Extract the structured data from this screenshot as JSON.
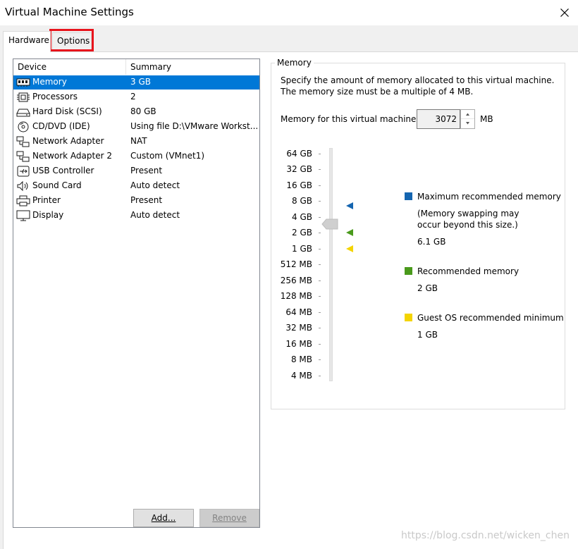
{
  "window": {
    "title": "Virtual Machine Settings"
  },
  "tabs": {
    "hardware": "Hardware",
    "options": "Options"
  },
  "device_list": {
    "headers": {
      "device": "Device",
      "summary": "Summary"
    },
    "rows": [
      {
        "icon": "memory-icon",
        "device": "Memory",
        "summary": "3 GB"
      },
      {
        "icon": "processor-icon",
        "device": "Processors",
        "summary": "2"
      },
      {
        "icon": "hard-disk-icon",
        "device": "Hard Disk (SCSI)",
        "summary": "80 GB"
      },
      {
        "icon": "cd-dvd-icon",
        "device": "CD/DVD (IDE)",
        "summary": "Using file D:\\VMware Workst..."
      },
      {
        "icon": "network-adapter-icon",
        "device": "Network Adapter",
        "summary": "NAT"
      },
      {
        "icon": "network-adapter-icon",
        "device": "Network Adapter 2",
        "summary": "Custom (VMnet1)"
      },
      {
        "icon": "usb-icon",
        "device": "USB Controller",
        "summary": "Present"
      },
      {
        "icon": "speaker-icon",
        "device": "Sound Card",
        "summary": "Auto detect"
      },
      {
        "icon": "printer-icon",
        "device": "Printer",
        "summary": "Present"
      },
      {
        "icon": "monitor-icon",
        "device": "Display",
        "summary": "Auto detect"
      }
    ]
  },
  "buttons": {
    "add": "Add...",
    "remove": "Remove"
  },
  "memory": {
    "group_title": "Memory",
    "desc_line1": "Specify the amount of memory allocated to this virtual machine.",
    "desc_line2": "The memory size must be a multiple of 4 MB.",
    "field_label": "Memory for this virtual machine:",
    "value": "3072",
    "unit": "MB",
    "scale": [
      "64 GB",
      "32 GB",
      "16 GB",
      "8 GB",
      "4 GB",
      "2 GB",
      "1 GB",
      "512 MB",
      "256 MB",
      "128 MB",
      "64 MB",
      "32 MB",
      "16 MB",
      "8 MB",
      "4 MB"
    ],
    "legend": {
      "max_title": "Maximum recommended memory",
      "max_note1": "(Memory swapping may",
      "max_note2": "occur beyond this size.)",
      "max_value": "6.1 GB",
      "rec_title": "Recommended memory",
      "rec_value": "2 GB",
      "min_title": "Guest OS recommended minimum",
      "min_value": "1 GB"
    }
  },
  "colors": {
    "selection": "#0078d7",
    "max_marker": "#1565b0",
    "recommended_marker": "#4a9a1c",
    "minimum_marker": "#f4d400",
    "highlight_box": "#e8141c"
  },
  "watermark": "https://blog.csdn.net/wicken_chen"
}
